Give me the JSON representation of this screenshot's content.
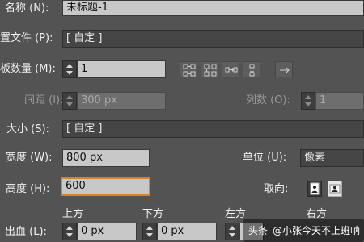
{
  "name_row": {
    "label": "名称 (N):",
    "value": "未标题-1"
  },
  "profile_row": {
    "label": "置文件 (P):",
    "value": "[ 自定 ]"
  },
  "artboards_row": {
    "label": "板数量 (M):",
    "value": "1"
  },
  "artboard_icons": [
    "grid-by-row-icon",
    "grid-by-column-icon",
    "arrange-by-row-icon",
    "arrange-by-column-icon",
    "right-to-left-icon"
  ],
  "spacing_row": {
    "label": "间距 (I):",
    "value": "300 px"
  },
  "columns_row": {
    "label": "列数 (O):",
    "value": "1"
  },
  "size_row": {
    "label": "大小 (S):",
    "value": "[ 自定 ]"
  },
  "width_row": {
    "label": "宽度 (W):",
    "value": "800 px"
  },
  "units_row": {
    "label": "单位 (U):",
    "value": "像素"
  },
  "height_row": {
    "label": "高度 (H):",
    "value": "600"
  },
  "orientation_row": {
    "label": "取向:",
    "options": [
      "portrait-icon",
      "landscape-icon"
    ],
    "selected": "portrait-icon"
  },
  "bleed_row": {
    "label": "出血 (L):",
    "top": {
      "label": "上方",
      "value": "0 px"
    },
    "bottom": {
      "label": "下方",
      "value": "0 px"
    },
    "left": {
      "label": "左方",
      "value": ""
    },
    "right": {
      "label": "右方",
      "value": ""
    }
  },
  "watermark": {
    "source": "头条",
    "author": "@小张今天不上班呐"
  },
  "colors": {
    "background": "#535353",
    "field": "#c8c8c8",
    "focus_border": "#d9822b"
  }
}
